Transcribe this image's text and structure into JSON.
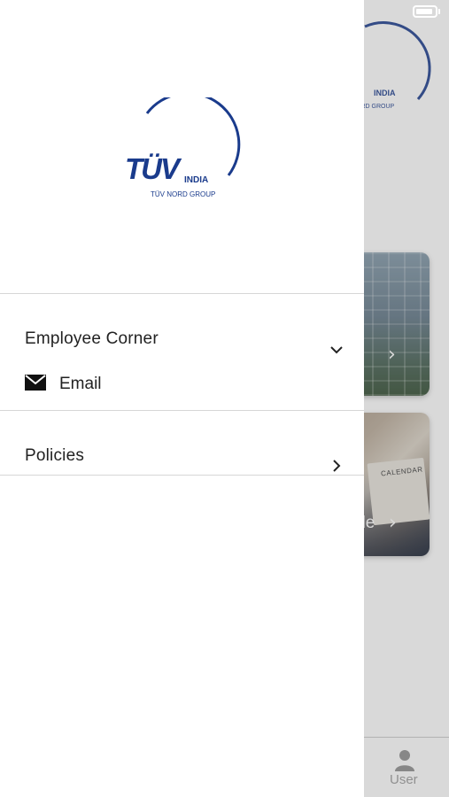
{
  "status_bar": {
    "battery_icon": "battery-icon"
  },
  "drawer": {
    "logo": {
      "brand": "TÜV",
      "sub": "INDIA",
      "group": "TÜV NORD GROUP",
      "colors": {
        "primary": "#1a3b8c"
      }
    },
    "sections": [
      {
        "title": "Employee Corner",
        "expanded": true,
        "icon": "chevron-down-icon",
        "items": [
          {
            "label": "Email",
            "icon": "mail-icon"
          }
        ]
      },
      {
        "title": "Policies",
        "expanded": false,
        "icon": "chevron-right-icon"
      }
    ]
  },
  "background": {
    "cards": [
      {
        "label": "",
        "icon": "chevron-right-icon"
      },
      {
        "label": "ule",
        "icon": "chevron-right-icon",
        "calendar_text": "CALENDAR"
      }
    ],
    "tabbar": {
      "user_label": "User",
      "user_icon": "user-icon"
    }
  }
}
